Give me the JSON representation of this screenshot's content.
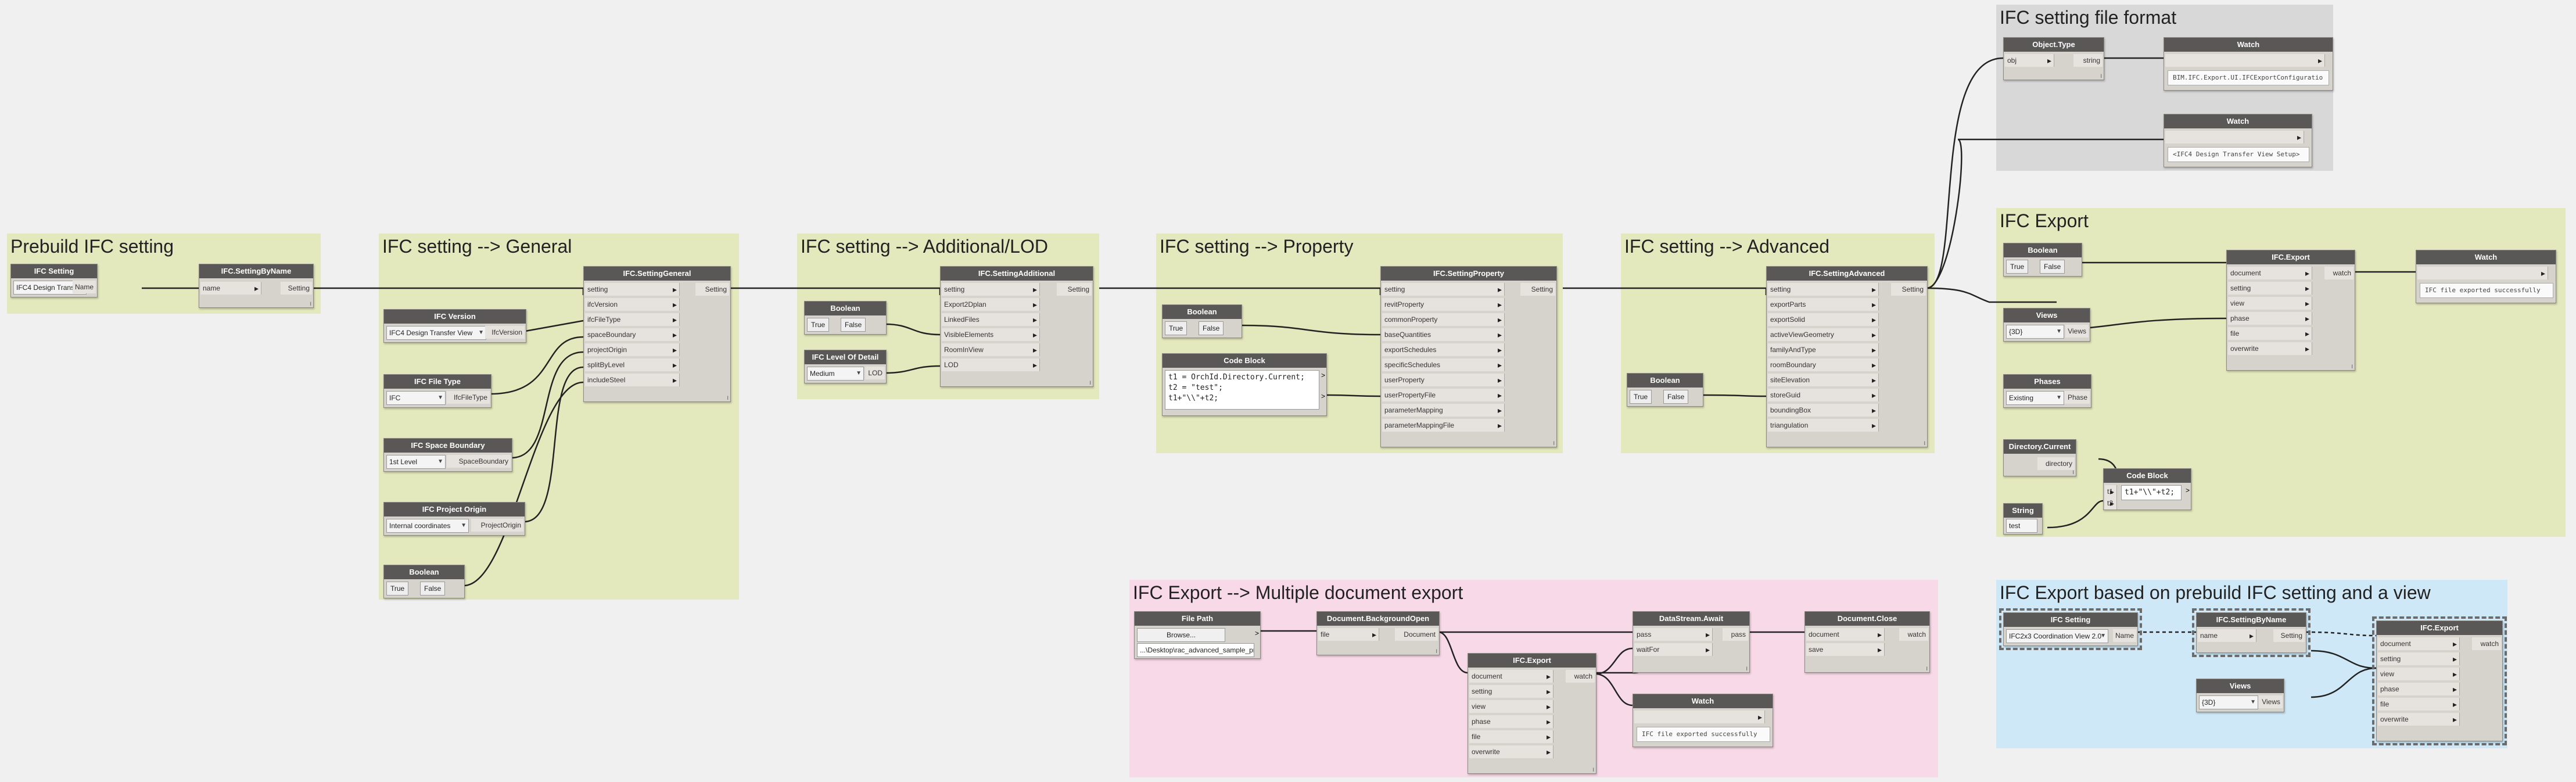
{
  "groups": {
    "prebuild": "Prebuild IFC setting",
    "general": "IFC setting --> General",
    "additional": "IFC setting --> Additional/LOD",
    "property": "IFC setting --> Property",
    "advanced": "IFC setting --> Advanced",
    "fileformat": "IFC setting file format",
    "export": "IFC Export",
    "multi": "IFC Export --> Multiple document export",
    "viewbased": "IFC Export based on prebuild IFC setting and a view"
  },
  "nodes": {
    "ifc_setting": {
      "title": "IFC Setting",
      "value": "IFC4 Design Transfer View",
      "out": "Name"
    },
    "ifc_setting_by_name": {
      "title": "IFC.SettingByName",
      "in": "name",
      "out": "Setting"
    },
    "ifc_version": {
      "title": "IFC Version",
      "value": "IFC4 Design Transfer View",
      "out": "IfcVersion"
    },
    "ifc_file_type": {
      "title": "IFC File Type",
      "value": "IFC",
      "out": "IfcFileType"
    },
    "ifc_space_boundary": {
      "title": "IFC Space Boundary",
      "value": "1st Level",
      "out": "SpaceBoundary"
    },
    "ifc_project_origin": {
      "title": "IFC Project Origin",
      "value": "Internal coordinates",
      "out": "ProjectOrigin"
    },
    "bool_general": {
      "title": "Boolean",
      "true": "True",
      "false": "False"
    },
    "setting_general": {
      "title": "IFC.SettingGeneral",
      "inputs": [
        "setting",
        "ifcVersion",
        "ifcFileType",
        "spaceBoundary",
        "projectOrigin",
        "splitByLevel",
        "includeSteel"
      ],
      "out": "Setting"
    },
    "bool_additional": {
      "title": "Boolean",
      "true": "True",
      "false": "False"
    },
    "ifc_lod": {
      "title": "IFC Level Of Detail",
      "value": "Medium",
      "out": "LOD"
    },
    "setting_additional": {
      "title": "IFC.SettingAdditional",
      "inputs": [
        "setting",
        "Export2Dplan",
        "LinkedFiles",
        "VisibleElements",
        "RoomInView",
        "LOD"
      ],
      "out": "Setting"
    },
    "bool_property": {
      "title": "Boolean",
      "true": "True",
      "false": "False"
    },
    "code_property": {
      "title": "Code Block",
      "lines": [
        "t1 = OrchId.Directory.Current;",
        "t2 = \"test\";",
        "t1+\"\\\\\"+t2;"
      ]
    },
    "setting_property": {
      "title": "IFC.SettingProperty",
      "inputs": [
        "setting",
        "revitProperty",
        "commonProperty",
        "baseQuantities",
        "exportSchedules",
        "specificSchedules",
        "userProperty",
        "userPropertyFile",
        "parameterMapping",
        "parameterMappingFile"
      ],
      "out": "Setting"
    },
    "bool_advanced": {
      "title": "Boolean",
      "true": "True",
      "false": "False"
    },
    "setting_advanced": {
      "title": "IFC.SettingAdvanced",
      "inputs": [
        "setting",
        "exportParts",
        "exportSolid",
        "activeViewGeometry",
        "familyAndType",
        "roomBoundary",
        "siteElevation",
        "storeGuid",
        "boundingBox",
        "triangulation"
      ],
      "out": "Setting"
    },
    "object_type": {
      "title": "Object.Type",
      "in": "obj",
      "out": "string"
    },
    "watch_type": {
      "title": "Watch",
      "value": "BIM.IFC.Export.UI.IFCExportConfiguratio"
    },
    "watch_setting": {
      "title": "Watch",
      "value": "<IFC4 Design Transfer View Setup>"
    },
    "bool_export": {
      "title": "Boolean",
      "true": "True",
      "false": "False"
    },
    "views_export": {
      "title": "Views",
      "value": "{3D}",
      "out": "Views"
    },
    "phases": {
      "title": "Phases",
      "value": "Existing",
      "out": "Phase"
    },
    "dir_current": {
      "title": "Directory.Current",
      "out": "directory"
    },
    "code_export": {
      "title": "Code Block",
      "in1": "t1",
      "in2": "t2",
      "line": "t1+\"\\\\\"+t2;"
    },
    "string_export": {
      "title": "String",
      "value": "test"
    },
    "ifc_export": {
      "title": "IFC.Export",
      "inputs": [
        "document",
        "setting",
        "view",
        "phase",
        "file",
        "overwrite"
      ],
      "out": "watch"
    },
    "watch_export": {
      "title": "Watch",
      "value": "IFC file exported successfully"
    },
    "file_path": {
      "title": "File Path",
      "button": "Browse...",
      "path": "...\\Desktop\\rac_advanced_sample_project.rvt"
    },
    "doc_background": {
      "title": "Document.BackgroundOpen",
      "in": "file",
      "out": "Document"
    },
    "ifc_export_multi": {
      "title": "IFC.Export",
      "inputs": [
        "document",
        "setting",
        "view",
        "phase",
        "file",
        "overwrite"
      ],
      "out": "watch"
    },
    "datastream": {
      "title": "DataStream.Await",
      "inputs": [
        "pass",
        "waitFor"
      ],
      "out": "pass"
    },
    "doc_close": {
      "title": "Document.Close",
      "inputs": [
        "document",
        "save"
      ],
      "out": "watch"
    },
    "watch_multi": {
      "title": "Watch",
      "value": "IFC file exported successfully"
    },
    "ifc_setting_vb": {
      "title": "IFC Setting",
      "value": "IFC2x3 Coordination View 2.0",
      "out": "Name"
    },
    "ifc_setting_by_name_vb": {
      "title": "IFC.SettingByName",
      "in": "name",
      "out": "Setting"
    },
    "views_vb": {
      "title": "Views",
      "value": "{3D}",
      "out": "Views"
    },
    "ifc_export_vb": {
      "title": "IFC.Export",
      "inputs": [
        "document",
        "setting",
        "view",
        "phase",
        "file",
        "overwrite"
      ],
      "out": "watch"
    }
  },
  "colors": {
    "node_header": "#5a5856",
    "node_body": "#d6d2cc",
    "group_green": "#e3e8bd",
    "group_gray": "#d8d8d8",
    "group_pink": "#f8d9e7",
    "group_blue": "#cfe8f7",
    "wire": "#222222"
  }
}
